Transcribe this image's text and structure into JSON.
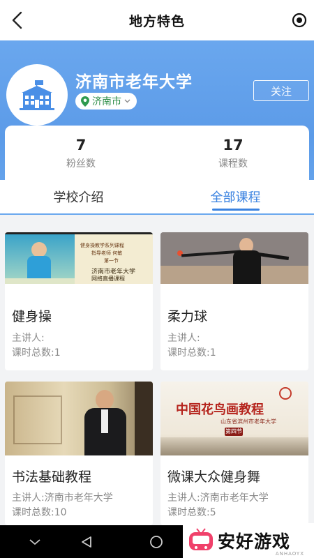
{
  "header": {
    "title": "地方特色",
    "back_icon": "chevron-left-icon",
    "right_icon": "target-icon"
  },
  "school": {
    "name": "济南市老年大学",
    "city": "济南市",
    "follow_label": "关注",
    "logo_icon": "school-building-icon"
  },
  "stats": [
    {
      "value": "7",
      "label": "粉丝数"
    },
    {
      "value": "17",
      "label": "课程数"
    }
  ],
  "tabs": [
    {
      "label": "学校介绍",
      "active": false
    },
    {
      "label": "全部课程",
      "active": true
    }
  ],
  "accent_color": "#3a82e0",
  "courses": [
    {
      "title": "健身操",
      "lecturer": "主讲人:",
      "hours": "课时总数:1",
      "thumb": {
        "title1": "健身操教学系列课程",
        "title2": "指导老师 何敏",
        "title3": "第一节",
        "org": "济南市老年大学",
        "sub": "网络直播课程"
      }
    },
    {
      "title": "柔力球",
      "lecturer": "主讲人:",
      "hours": "课时总数:1",
      "thumb": {}
    },
    {
      "title": "书法基础教程",
      "lecturer": "主讲人:济南市老年大学",
      "hours": "课时总数:10",
      "thumb": {}
    },
    {
      "title": "微课大众健身舞",
      "lecturer": "主讲人:济南市老年大学",
      "hours": "课时总数:5",
      "thumb": {
        "title1": "中国花鸟画教程",
        "org": "山东省滨州市老年大学",
        "sub": "第四节"
      }
    }
  ],
  "watermark": {
    "text": "安好游戏",
    "sub": "ANHAOYX"
  }
}
